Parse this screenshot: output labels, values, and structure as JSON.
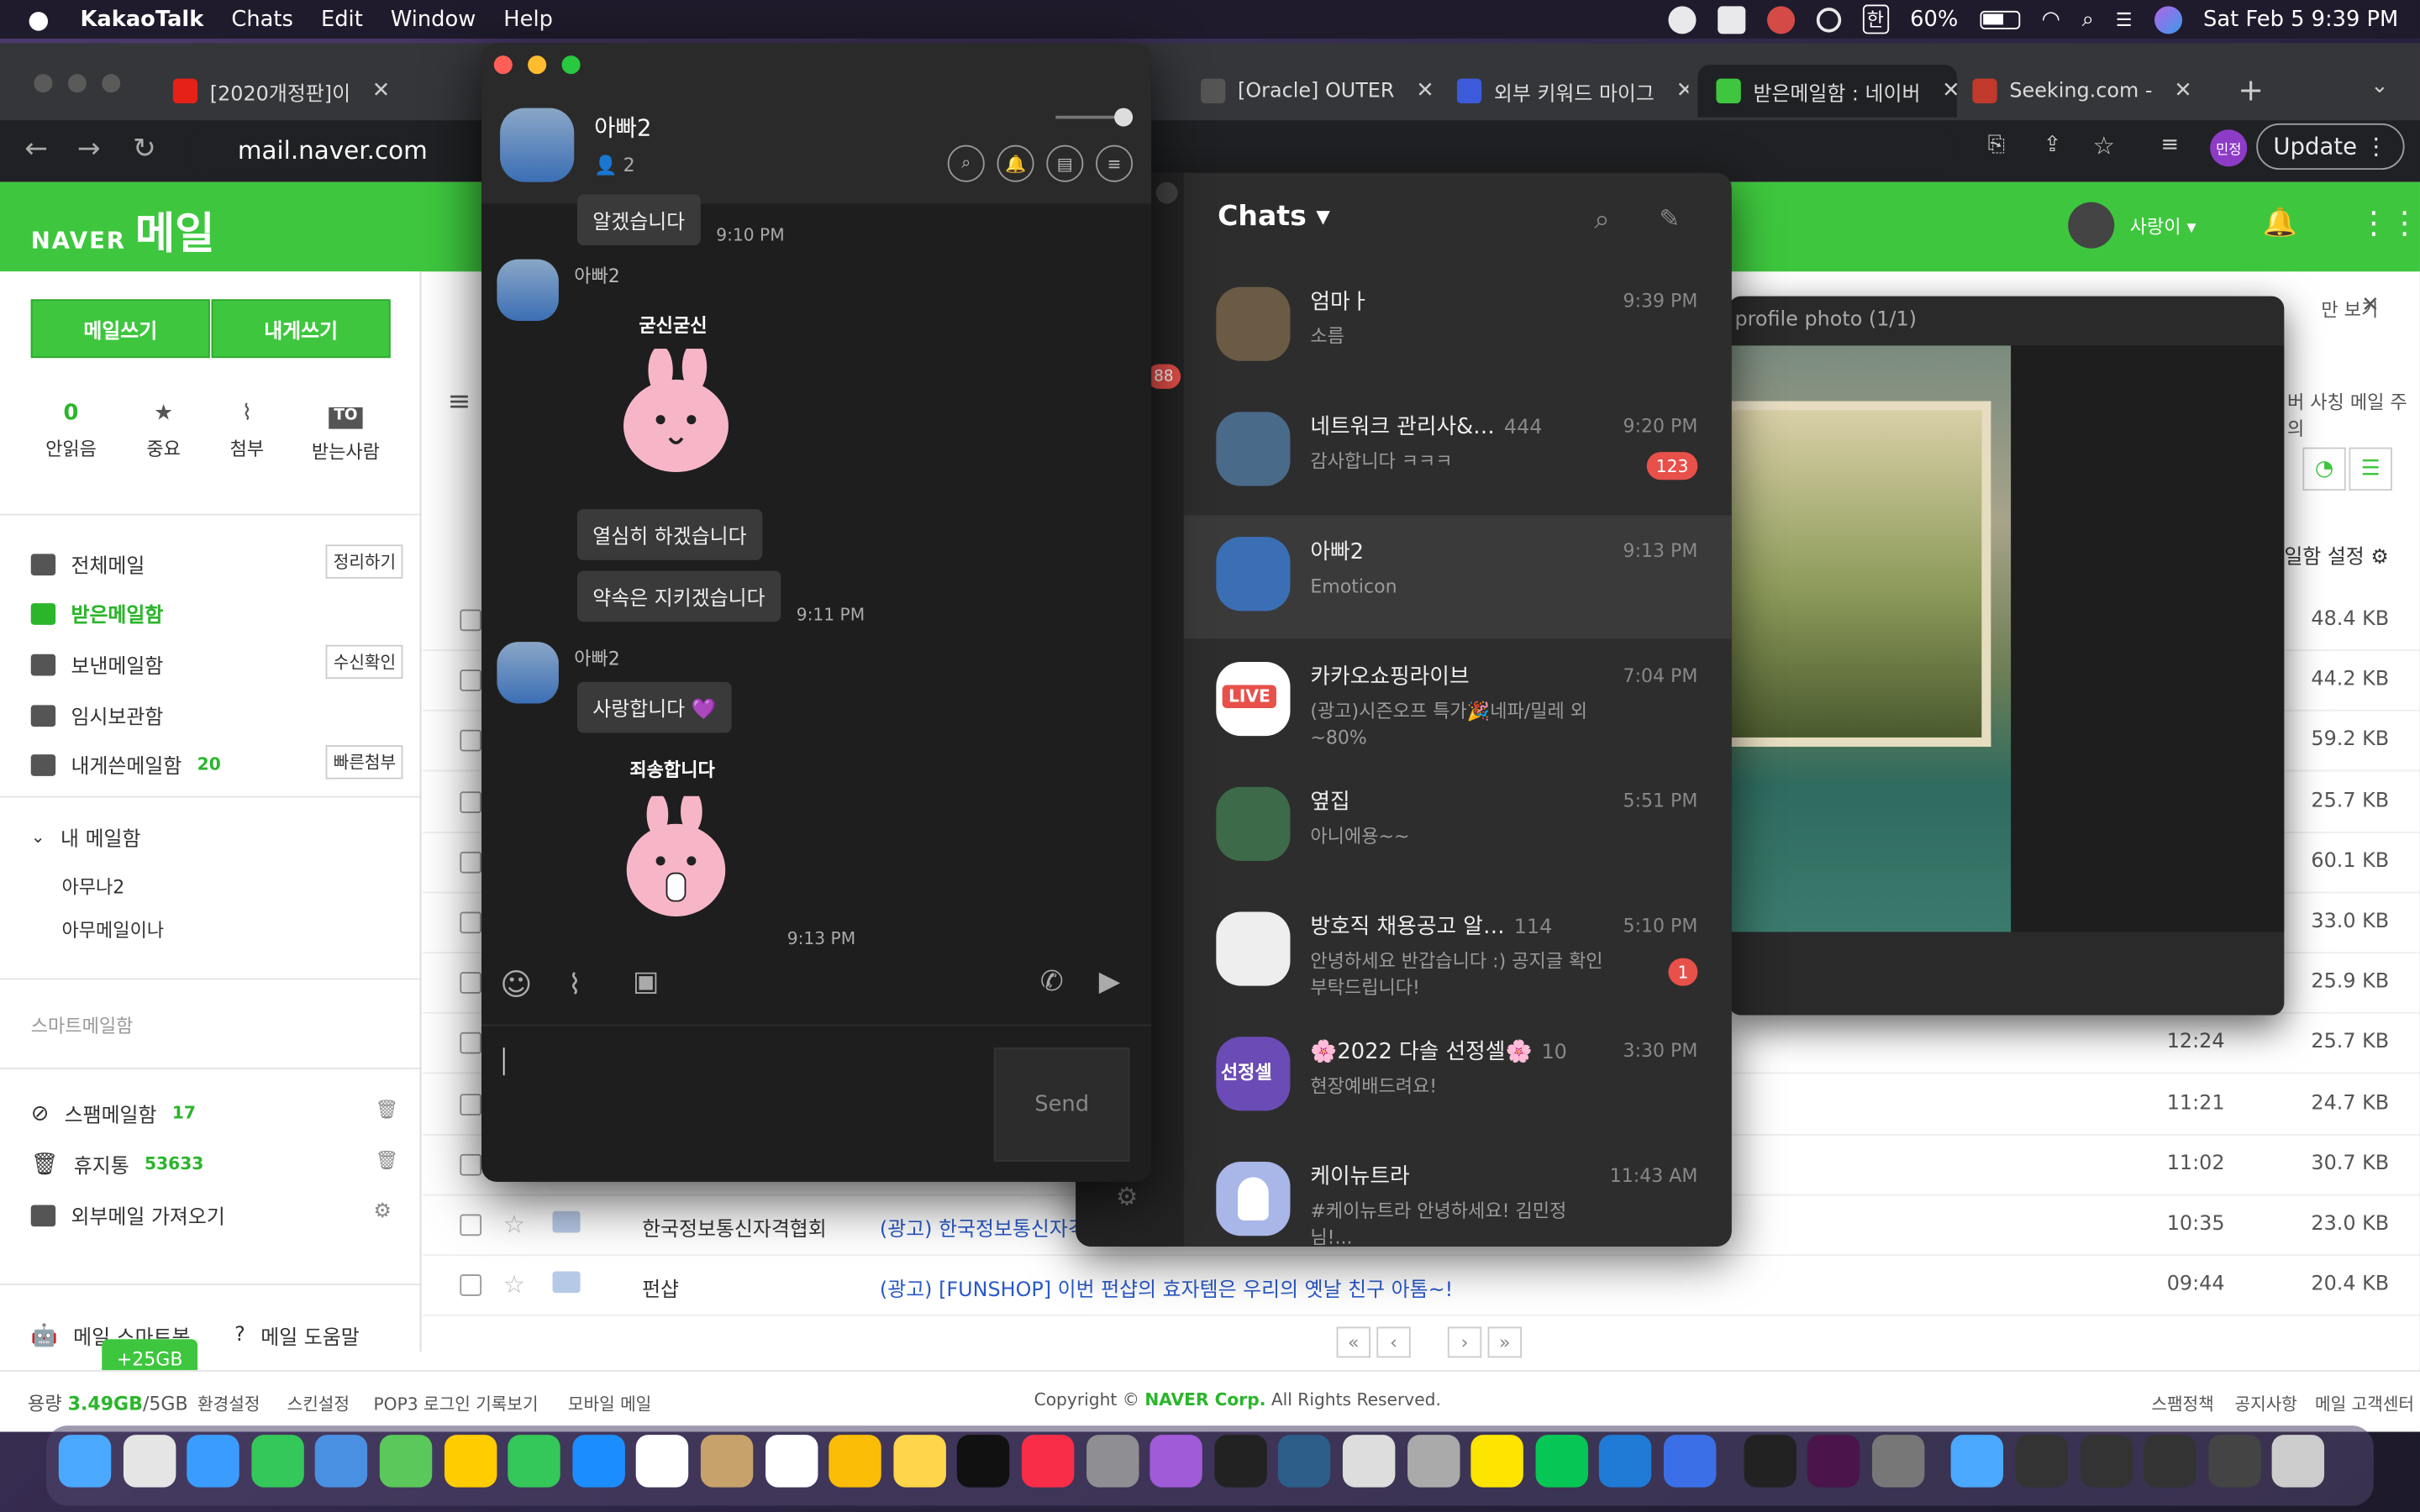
{
  "menubar": {
    "app": "KakaoTalk",
    "items": [
      "Chats",
      "Edit",
      "Window",
      "Help"
    ],
    "battery": "60%",
    "clock": "Sat Feb 5  9:39 PM",
    "keyboard": "한"
  },
  "browser": {
    "tabs": [
      {
        "title": "[2020개정판]이 ",
        "color": "#e62117"
      },
      {
        "title": "[Oracle] OUTER",
        "color": "#444"
      },
      {
        "title": "외부 키워드 마이그",
        "color": "#3b5bdb"
      },
      {
        "title": "받은메일함 : 네이버",
        "color": "#3ec73e"
      },
      {
        "title": "Seeking.com - ",
        "color": "#c0392b"
      }
    ],
    "url": "mail.naver.com",
    "update_label": "Update",
    "profile_initials": "민정"
  },
  "naver": {
    "logo_prefix": "NAVER",
    "logo_text": "메일",
    "user": "사랑이 ▾",
    "write_label": "메일쓰기",
    "self_write_label": "내게쓰기",
    "quick": [
      {
        "top": "0",
        "label": "안읽음"
      },
      {
        "top": "★",
        "label": "중요"
      },
      {
        "top": "⌇",
        "label": "첨부"
      },
      {
        "top": "TO",
        "label": "받는사람"
      }
    ],
    "folders": [
      {
        "label": "전체메일",
        "btn": "정리하기"
      },
      {
        "label": "받은메일함",
        "btn": ""
      },
      {
        "label": "보낸메일함",
        "btn": "수신확인"
      },
      {
        "label": "임시보관함",
        "btn": ""
      },
      {
        "label": "내게쓴메일함",
        "count": "20",
        "btn": "빠른첨부"
      }
    ],
    "my_mailbox": "내 메일함",
    "sub_folders": [
      "아무나2",
      "아무메일이나"
    ],
    "smart": "스마트메일함",
    "spam": {
      "label": "스팸메일함",
      "count": "17"
    },
    "trash": {
      "label": "휴지통",
      "count": "53633"
    },
    "external": "외부메일 가져오기",
    "bot": "메일 스마트봇",
    "help": "메일 도움말",
    "extra_gb": "+25GB",
    "photo_title": "profile photo (1/1)",
    "right_close_label": "만 보기",
    "notice": "버 사칭 메일 주의",
    "mailbox_settings": "일함 설정",
    "rows": [
      {
        "time": "",
        "size": "48.4 KB"
      },
      {
        "time": "",
        "size": "44.2 KB"
      },
      {
        "time": "",
        "size": "59.2 KB"
      },
      {
        "time": "",
        "size": "25.7 KB"
      },
      {
        "time": "",
        "size": "60.1 KB"
      },
      {
        "time": "",
        "size": "33.0 KB"
      },
      {
        "time": "",
        "size": "25.9 KB"
      },
      {
        "time": "12:24",
        "size": "25.7 KB"
      },
      {
        "time": "11:21",
        "size": "24.7 KB"
      },
      {
        "time": "11:02",
        "size": "30.7 KB"
      },
      {
        "time": "10:35",
        "size": "23.0 KB",
        "sender": "한국정보통신자격협회",
        "subject": "(광고) 한국정보통신자격"
      },
      {
        "time": "09:44",
        "size": "20.4 KB",
        "sender": "펀샵",
        "subject": "(광고) [FUNSHOP] 이번 펀샵의 효자템은 우리의 옛날 친구 아톰~!"
      }
    ],
    "footer": {
      "usage_label": "용량",
      "usage": "3.49GB",
      "total": "/5GB",
      "links": [
        "환경설정",
        "스킨설정",
        "POP3 로그인 기록보기",
        "모바일 메일"
      ],
      "copyright_pre": "Copyright ©",
      "corp": "NAVER Corp.",
      "rights": "All Rights Reserved.",
      "right_links": [
        "스팸정책",
        "공지사항",
        "메일 고객센터"
      ]
    }
  },
  "kakao_chats": {
    "title": "Chats ▾",
    "items": [
      {
        "name": "엄마ㅏ",
        "msg": "소름",
        "time": "9:39 PM",
        "badge": "",
        "count": "",
        "avatar": "#6b5b45"
      },
      {
        "name": "네트워크 관리사&…",
        "count": "444",
        "msg": "감사합니다 ㅋㅋㅋ",
        "time": "9:20 PM",
        "badge": "123",
        "avatar": "#4a6a8a"
      },
      {
        "name": "아빠2",
        "count": "",
        "msg": "Emoticon",
        "time": "9:13 PM",
        "badge": "",
        "avatar": "#3b6fb5"
      },
      {
        "name": "카카오쇼핑라이브",
        "count": "",
        "msg": "(광고)시즌오프 특가🎉네파/밀레 외~80%",
        "time": "7:04 PM",
        "badge": "",
        "avatar": "#ffffff"
      },
      {
        "name": "옆집",
        "count": "",
        "msg": "아니에용~~",
        "time": "5:51 PM",
        "badge": "",
        "avatar": "#3d6b4a"
      },
      {
        "name": "방호직 채용공고 알…",
        "count": "114",
        "msg": "안녕하세요 반갑습니다 :) 공지글 확인 부탁드립니다!",
        "time": "5:10 PM",
        "badge": "1",
        "avatar": "#eeeeee"
      },
      {
        "name": "🌸2022 다솔 선정셀🌸",
        "count": "10",
        "msg": "현장예배드려요!",
        "time": "3:30 PM",
        "badge": "",
        "avatar": "#6b4bb5"
      },
      {
        "name": "케이뉴트라",
        "count": "",
        "msg": "#케이뉴트라 안녕하세요! 김민정님!...",
        "time": "11:43 AM",
        "badge": "",
        "avatar": "#a9b6e8"
      }
    ],
    "live_label": "LIVE",
    "group_label": "선정셀"
  },
  "kakao_room": {
    "name": "아빠2",
    "members": "2",
    "messages": [
      {
        "type": "text",
        "text": "알겠습니다",
        "time": "9:10 PM"
      },
      {
        "type": "sender",
        "text": "아빠2"
      },
      {
        "type": "sticker",
        "text": "굳신굳신"
      },
      {
        "type": "text",
        "text": "열심히 하겠습니다"
      },
      {
        "type": "text",
        "text": "약속은 지키겠습니다",
        "time": "9:11 PM"
      },
      {
        "type": "sender",
        "text": "아빠2"
      },
      {
        "type": "text",
        "text": "사랑합니다 💜"
      },
      {
        "type": "sticker",
        "text": "죄송합니다",
        "time": "9:13 PM"
      }
    ],
    "send_label": "Send"
  }
}
